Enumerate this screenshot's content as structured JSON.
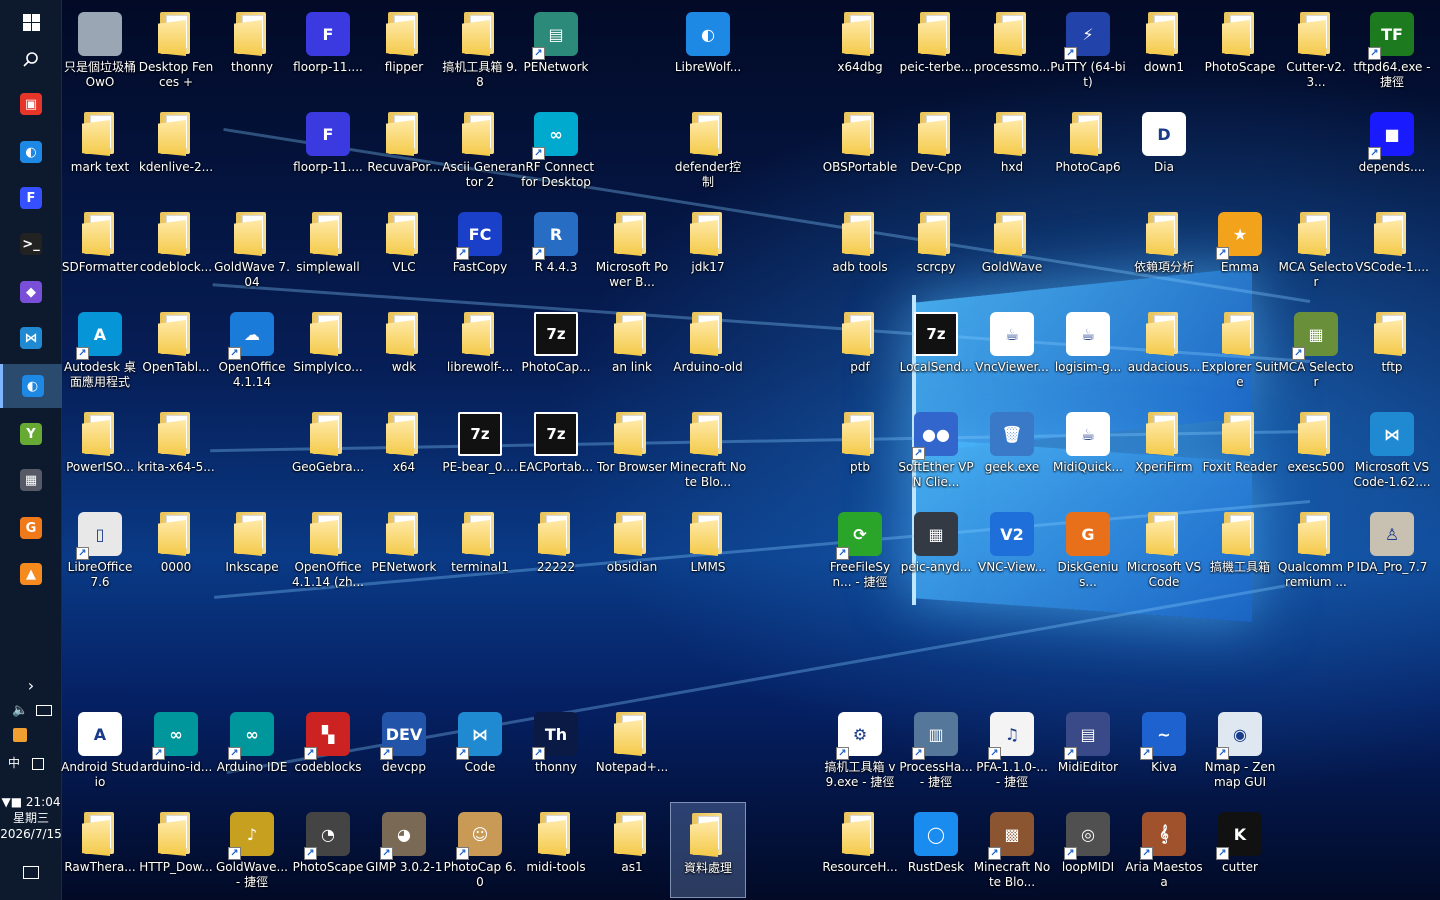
{
  "taskbar": {
    "start_icon": "windows-logo-icon",
    "search_icon": "search-icon",
    "pinned": [
      {
        "name": "taskbar-app-1",
        "icon": "red-grid-app-icon",
        "color": "#e8352a",
        "glyph": "▣"
      },
      {
        "name": "taskbar-app-2",
        "icon": "librewolf-icon",
        "color": "#1e88e5",
        "glyph": "◐"
      },
      {
        "name": "taskbar-app-3",
        "icon": "floorp-icon",
        "color": "#3550ff",
        "glyph": "F"
      },
      {
        "name": "taskbar-app-4",
        "icon": "terminal-icon",
        "color": "#222222",
        "glyph": ">_"
      },
      {
        "name": "taskbar-app-5",
        "icon": "obsidian-icon",
        "color": "#7a4fd8",
        "glyph": "◆"
      },
      {
        "name": "taskbar-app-6",
        "icon": "vscode-icon",
        "color": "#1f8ad2",
        "glyph": "⋈"
      },
      {
        "name": "taskbar-app-7",
        "icon": "librewolf-active-icon",
        "color": "#1e88e5",
        "glyph": "◐"
      },
      {
        "name": "taskbar-app-8",
        "icon": "green-y-app-icon",
        "color": "#66aa33",
        "glyph": "Y"
      },
      {
        "name": "taskbar-app-9",
        "icon": "chip-app-icon",
        "color": "#555a66",
        "glyph": "▦"
      },
      {
        "name": "taskbar-app-10",
        "icon": "pdf-app-icon",
        "color": "#f07a1a",
        "glyph": "G"
      },
      {
        "name": "taskbar-app-11",
        "icon": "vlc-icon",
        "color": "#f58a1f",
        "glyph": "▲"
      }
    ],
    "tray": {
      "expand": "›",
      "volume_icon": "speaker-icon",
      "network_icon": "network-icon",
      "ime": "中",
      "clock_time": "▼■ 21:04",
      "clock_day": "星期三",
      "clock_date": "2026/7/15",
      "notification_icon": "action-center-icon"
    }
  },
  "desktop_icons": [
    {
      "label": "只是個垃圾桶 OwO",
      "icon": "recycle-bin-icon",
      "type": "app",
      "color": "#9aa6b4"
    },
    {
      "label": "Desktop Fences +",
      "icon": "folder-icon",
      "type": "folder"
    },
    {
      "label": "thonny",
      "icon": "folder-icon",
      "type": "folder"
    },
    {
      "label": "floorp-11....",
      "icon": "floorp-icon",
      "type": "app",
      "color": "#3a3ae0",
      "glyph": "F"
    },
    {
      "label": "flipper",
      "icon": "folder-icon",
      "type": "folder"
    },
    {
      "label": "搞机工具箱 9.8",
      "icon": "folder-icon",
      "type": "folder"
    },
    {
      "label": "PENetwork",
      "icon": "penetwork-icon",
      "type": "app",
      "color": "#2b8a7a",
      "glyph": "▤",
      "shortcut": true
    },
    {
      "label": "LibreWolf...",
      "icon": "librewolf-file-icon",
      "type": "app",
      "color": "#1e88e5",
      "glyph": "◐"
    },
    {
      "label": "x64dbg",
      "icon": "folder-icon",
      "type": "folder"
    },
    {
      "label": "peic-terbe...",
      "icon": "folder-icon",
      "type": "folder"
    },
    {
      "label": "processmo...",
      "icon": "folder-icon",
      "type": "folder"
    },
    {
      "label": "PuTTY (64-bit)",
      "icon": "putty-icon",
      "type": "app",
      "color": "#2244aa",
      "glyph": "⚡",
      "shortcut": true
    },
    {
      "label": "down1",
      "icon": "folder-icon",
      "type": "folder"
    },
    {
      "label": "PhotoScape",
      "icon": "folder-icon",
      "type": "folder"
    },
    {
      "label": "Cutter-v2.3...",
      "icon": "folder-icon",
      "type": "folder"
    },
    {
      "label": "tftpd64.exe - 捷徑",
      "icon": "tftpd-icon",
      "type": "app",
      "color": "#1e7a1e",
      "glyph": "TF",
      "shortcut": true
    },
    {
      "label": "mark text",
      "icon": "folder-icon",
      "type": "folder"
    },
    {
      "label": "kdenlive-2...",
      "icon": "folder-icon",
      "type": "folder"
    },
    {
      "label": "floorp-11....",
      "icon": "floorp-icon",
      "type": "app",
      "color": "#3a3ae0",
      "glyph": "F"
    },
    {
      "label": "RecuvaPor...",
      "icon": "folder-icon",
      "type": "folder"
    },
    {
      "label": "Ascii Generator 2",
      "icon": "folder-icon",
      "type": "folder"
    },
    {
      "label": "nRF Connect for Desktop",
      "icon": "nrf-connect-icon",
      "type": "app",
      "color": "#00a9ce",
      "glyph": "∞",
      "shortcut": true
    },
    {
      "label": "defender控制",
      "icon": "folder-icon",
      "type": "folder"
    },
    {
      "label": "OBSPortable",
      "icon": "folder-icon",
      "type": "folder"
    },
    {
      "label": "Dev-Cpp",
      "icon": "folder-icon",
      "type": "folder"
    },
    {
      "label": "hxd",
      "icon": "folder-icon",
      "type": "folder"
    },
    {
      "label": "PhotoCap6",
      "icon": "folder-icon",
      "type": "folder"
    },
    {
      "label": "Dia",
      "icon": "dia-icon",
      "type": "app",
      "color": "#ffffff",
      "glyph": "D",
      "dark": true
    },
    {
      "label": "depends....",
      "icon": "depends-icon",
      "type": "app",
      "color": "#1a1aff",
      "glyph": "■",
      "shortcut": true
    },
    {
      "label": "SDFormatter",
      "icon": "folder-icon",
      "type": "folder"
    },
    {
      "label": "codeblock...",
      "icon": "folder-icon",
      "type": "folder"
    },
    {
      "label": "GoldWave 7.04",
      "icon": "folder-icon",
      "type": "folder"
    },
    {
      "label": "simplewall",
      "icon": "folder-icon",
      "type": "folder"
    },
    {
      "label": "VLC",
      "icon": "folder-icon",
      "type": "folder"
    },
    {
      "label": "FastCopy",
      "icon": "fastcopy-icon",
      "type": "app",
      "color": "#1a3fc8",
      "glyph": "FC",
      "shortcut": true
    },
    {
      "label": "R 4.4.3",
      "icon": "r-language-icon",
      "type": "app",
      "color": "#276dc3",
      "glyph": "R",
      "shortcut": true
    },
    {
      "label": "Microsoft Power B...",
      "icon": "folder-icon",
      "type": "folder"
    },
    {
      "label": "jdk17",
      "icon": "folder-icon",
      "type": "folder"
    },
    {
      "label": "adb tools",
      "icon": "folder-icon",
      "type": "folder"
    },
    {
      "label": "scrcpy",
      "icon": "folder-icon",
      "type": "folder"
    },
    {
      "label": "GoldWave",
      "icon": "folder-icon",
      "type": "folder"
    },
    {
      "label": "依賴項分析",
      "icon": "folder-icon",
      "type": "folder"
    },
    {
      "label": "Emma",
      "icon": "emma-star-icon",
      "type": "app",
      "color": "#f3a21b",
      "glyph": "★",
      "shortcut": true
    },
    {
      "label": "MCA Selector",
      "icon": "folder-icon",
      "type": "folder"
    },
    {
      "label": "VSCode-1....",
      "icon": "folder-icon",
      "type": "folder"
    },
    {
      "label": "Autodesk 桌面應用程式",
      "icon": "autodesk-icon",
      "type": "app",
      "color": "#0696d7",
      "glyph": "A",
      "shortcut": true
    },
    {
      "label": "OpenTabl...",
      "icon": "folder-icon",
      "type": "folder"
    },
    {
      "label": "OpenOffice 4.1.14",
      "icon": "openoffice-icon",
      "type": "app",
      "color": "#1a7cd8",
      "glyph": "☁",
      "shortcut": true
    },
    {
      "label": "SimplyIco...",
      "icon": "folder-icon",
      "type": "folder"
    },
    {
      "label": "wdk",
      "icon": "folder-icon",
      "type": "folder"
    },
    {
      "label": "librewolf-...",
      "icon": "folder-icon",
      "type": "folder"
    },
    {
      "label": "PhotoCap...",
      "icon": "7zip-icon",
      "type": "app",
      "color": "#111111",
      "glyph": "7z",
      "boxed": true
    },
    {
      "label": "an link",
      "icon": "folder-icon",
      "type": "folder"
    },
    {
      "label": "Arduino-old",
      "icon": "folder-icon",
      "type": "folder"
    },
    {
      "label": "pdf",
      "icon": "folder-icon",
      "type": "folder"
    },
    {
      "label": "LocalSend...",
      "icon": "7zip-icon",
      "type": "app",
      "color": "#111111",
      "glyph": "7z",
      "boxed": true
    },
    {
      "label": "VncViewer...",
      "icon": "java-icon",
      "type": "app",
      "color": "#ffffff",
      "glyph": "☕",
      "dark": true
    },
    {
      "label": "logisim-g...",
      "icon": "java-icon",
      "type": "app",
      "color": "#ffffff",
      "glyph": "☕",
      "dark": true
    },
    {
      "label": "audacious...",
      "icon": "folder-icon",
      "type": "folder"
    },
    {
      "label": "Explorer Suite",
      "icon": "folder-icon",
      "type": "folder"
    },
    {
      "label": "MCA Selector",
      "icon": "mca-selector-icon",
      "type": "app",
      "color": "#6a8f3a",
      "glyph": "▦",
      "shortcut": true
    },
    {
      "label": "tftp",
      "icon": "folder-icon",
      "type": "folder"
    },
    {
      "label": "PowerISO...",
      "icon": "folder-icon",
      "type": "folder"
    },
    {
      "label": "krita-x64-5...",
      "icon": "folder-icon",
      "type": "folder"
    },
    {
      "label": "GeoGebra...",
      "icon": "folder-icon",
      "type": "folder"
    },
    {
      "label": "x64",
      "icon": "folder-icon",
      "type": "folder"
    },
    {
      "label": "PE-bear_0....",
      "icon": "7zip-icon",
      "type": "app",
      "color": "#111111",
      "glyph": "7z",
      "boxed": true
    },
    {
      "label": "EACPortab...",
      "icon": "7zip-icon",
      "type": "app",
      "color": "#111111",
      "glyph": "7z",
      "boxed": true
    },
    {
      "label": "Tor Browser",
      "icon": "folder-icon",
      "type": "folder"
    },
    {
      "label": "Minecraft Note Blo...",
      "icon": "folder-icon",
      "type": "folder"
    },
    {
      "label": "ptb",
      "icon": "folder-icon",
      "type": "folder"
    },
    {
      "label": "SoftEther VPN Clie...",
      "icon": "softether-icon",
      "type": "app",
      "color": "#3366cc",
      "glyph": "●●",
      "shortcut": true
    },
    {
      "label": "geek.exe",
      "icon": "geek-uninstaller-icon",
      "type": "app",
      "color": "#3a78c8",
      "glyph": "🗑"
    },
    {
      "label": "MidiQuick...",
      "icon": "java-icon",
      "type": "app",
      "color": "#ffffff",
      "glyph": "☕",
      "dark": true
    },
    {
      "label": "XperiFirm",
      "icon": "folder-icon",
      "type": "folder"
    },
    {
      "label": "Foxit Reader",
      "icon": "folder-icon",
      "type": "folder"
    },
    {
      "label": "exesc500",
      "icon": "folder-icon",
      "type": "folder"
    },
    {
      "label": "Microsoft VS Code-1.62....",
      "icon": "vscode-file-icon",
      "type": "app",
      "color": "#1f8ad2",
      "glyph": "⋈"
    },
    {
      "label": "LibreOffice 7.6",
      "icon": "libreoffice-icon",
      "type": "app",
      "color": "#e8e8e8",
      "glyph": "▯",
      "shortcut": true,
      "dark": true
    },
    {
      "label": "0000",
      "icon": "folder-icon",
      "type": "folder"
    },
    {
      "label": "Inkscape",
      "icon": "folder-icon",
      "type": "folder"
    },
    {
      "label": "OpenOffice 4.1.14 (zh...",
      "icon": "folder-icon",
      "type": "folder"
    },
    {
      "label": "PENetwork",
      "icon": "folder-icon",
      "type": "folder"
    },
    {
      "label": "terminal1",
      "icon": "folder-icon",
      "type": "folder"
    },
    {
      "label": "22222",
      "icon": "folder-icon",
      "type": "folder"
    },
    {
      "label": "obsidian",
      "icon": "folder-icon",
      "type": "folder"
    },
    {
      "label": "LMMS",
      "icon": "folder-icon",
      "type": "folder"
    },
    {
      "label": "FreeFileSyn... - 捷徑",
      "icon": "freefilesync-icon",
      "type": "app",
      "color": "#2aa52a",
      "glyph": "⟳",
      "shortcut": true
    },
    {
      "label": "peic-anyd...",
      "icon": "chip-icon",
      "type": "app",
      "color": "#333a44",
      "glyph": "▦"
    },
    {
      "label": "VNC-View...",
      "icon": "vnc-viewer-icon",
      "type": "app",
      "color": "#1e6fd9",
      "glyph": "V2"
    },
    {
      "label": "DiskGenius...",
      "icon": "diskgenius-icon",
      "type": "app",
      "color": "#e8701a",
      "glyph": "G"
    },
    {
      "label": "Microsoft VS Code",
      "icon": "folder-icon",
      "type": "folder"
    },
    {
      "label": "搞機工具箱",
      "icon": "folder-icon",
      "type": "folder"
    },
    {
      "label": "Qualcomm Premium ...",
      "icon": "folder-icon",
      "type": "folder"
    },
    {
      "label": "IDA_Pro_7.7",
      "icon": "ida-pro-icon",
      "type": "app",
      "color": "#c8c0b0",
      "glyph": "♙",
      "dark": true
    },
    {
      "label": "Android Studio",
      "icon": "android-studio-icon",
      "type": "app",
      "color": "#ffffff",
      "glyph": "A",
      "dark": true
    },
    {
      "label": "arduino-id...",
      "icon": "arduino-icon",
      "type": "app",
      "color": "#00979c",
      "glyph": "∞",
      "shortcut": true
    },
    {
      "label": "Arduino IDE",
      "icon": "arduino-icon",
      "type": "app",
      "color": "#00979c",
      "glyph": "∞",
      "shortcut": true
    },
    {
      "label": "codeblocks",
      "icon": "codeblocks-icon",
      "type": "app",
      "color": "#cc2222",
      "glyph": "▚",
      "shortcut": true
    },
    {
      "label": "devcpp",
      "icon": "devcpp-icon",
      "type": "app",
      "color": "#2255aa",
      "glyph": "DEV",
      "shortcut": true
    },
    {
      "label": "Code",
      "icon": "vscode-icon",
      "type": "app",
      "color": "#1f8ad2",
      "glyph": "⋈",
      "shortcut": true
    },
    {
      "label": "thonny",
      "icon": "thonny-icon",
      "type": "app",
      "color": "#0a1a44",
      "glyph": "Th",
      "shortcut": true
    },
    {
      "label": "Notepad+...",
      "icon": "folder-icon",
      "type": "folder"
    },
    {
      "label": "搞机工具箱 v9.exe - 捷徑",
      "icon": "gear-icon",
      "type": "app",
      "color": "#ffffff",
      "glyph": "⚙",
      "shortcut": true,
      "dark": true
    },
    {
      "label": "ProcessHa... - 捷徑",
      "icon": "process-hacker-icon",
      "type": "app",
      "color": "#557799",
      "glyph": "▥",
      "shortcut": true
    },
    {
      "label": "PFA-1.1.0-... - 捷徑",
      "icon": "piano-icon",
      "type": "app",
      "color": "#f4f4f4",
      "glyph": "♫",
      "shortcut": true,
      "dark": true
    },
    {
      "label": "MidiEditor",
      "icon": "midieditor-icon",
      "type": "app",
      "color": "#3a4a88",
      "glyph": "▤",
      "shortcut": true
    },
    {
      "label": "Kiva",
      "icon": "kiva-icon",
      "type": "app",
      "color": "#1e62d0",
      "glyph": "~",
      "shortcut": true
    },
    {
      "label": "Nmap - Zenmap GUI",
      "icon": "nmap-eye-icon",
      "type": "app",
      "color": "#dfe8f0",
      "glyph": "◉",
      "shortcut": true,
      "dark": true
    },
    {
      "label": "RawThera...",
      "icon": "folder-icon",
      "type": "folder"
    },
    {
      "label": "HTTP_Dow...",
      "icon": "folder-icon",
      "type": "folder"
    },
    {
      "label": "GoldWave... - 捷徑",
      "icon": "goldwave-icon",
      "type": "app",
      "color": "#c8a020",
      "glyph": "♪",
      "shortcut": true
    },
    {
      "label": "PhotoScape",
      "icon": "photoscape-icon",
      "type": "app",
      "color": "#444444",
      "glyph": "◔",
      "shortcut": true
    },
    {
      "label": "GIMP 3.0.2-1",
      "icon": "gimp-icon",
      "type": "app",
      "color": "#7a6a55",
      "glyph": "◕",
      "shortcut": true
    },
    {
      "label": "PhotoCap 6.0",
      "icon": "photocap-icon",
      "type": "app",
      "color": "#c89a55",
      "glyph": "☺",
      "shortcut": true
    },
    {
      "label": "midi-tools",
      "icon": "folder-icon",
      "type": "folder"
    },
    {
      "label": "as1",
      "icon": "folder-icon",
      "type": "folder"
    },
    {
      "label": "資料處理",
      "icon": "folder-icon",
      "type": "folder",
      "selected": true
    },
    {
      "label": "ResourceH...",
      "icon": "folder-icon",
      "type": "folder"
    },
    {
      "label": "RustDesk",
      "icon": "rustdesk-icon",
      "type": "app",
      "color": "#1a8cf0",
      "glyph": "◯"
    },
    {
      "label": "Minecraft Note Blo...",
      "icon": "note-block-icon",
      "type": "app",
      "color": "#8a5530",
      "glyph": "▩",
      "shortcut": true
    },
    {
      "label": "loopMIDI",
      "icon": "loopmidi-icon",
      "type": "app",
      "color": "#505050",
      "glyph": "◎",
      "shortcut": true
    },
    {
      "label": "Aria Maestosa",
      "icon": "violin-icon",
      "type": "app",
      "color": "#a0522d",
      "glyph": "𝄞",
      "shortcut": true
    },
    {
      "label": "cutter",
      "icon": "cutter-icon",
      "type": "app",
      "color": "#111111",
      "glyph": "K",
      "shortcut": true
    }
  ]
}
